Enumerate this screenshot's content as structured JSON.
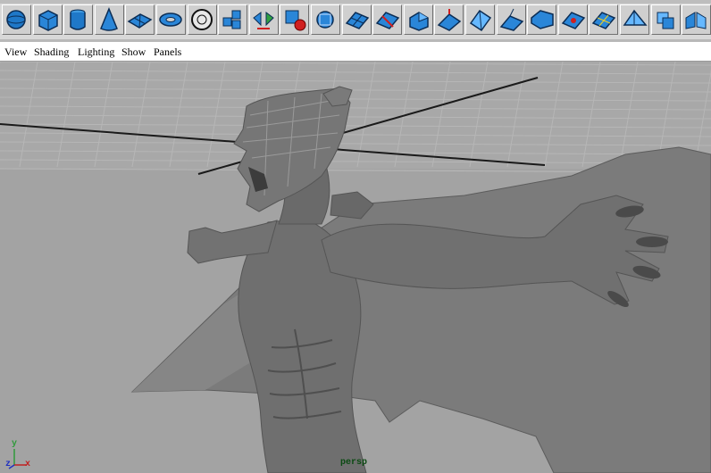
{
  "shelf": {
    "icons": [
      {
        "name": "sphere-icon"
      },
      {
        "name": "cube-icon"
      },
      {
        "name": "cylinder-icon"
      },
      {
        "name": "cone-icon"
      },
      {
        "name": "plane-icon"
      },
      {
        "name": "torus-icon"
      },
      {
        "name": "soccer-ball-icon"
      },
      {
        "name": "combine-icon"
      },
      {
        "name": "separate-icon"
      },
      {
        "name": "extract-icon"
      },
      {
        "name": "smooth-icon"
      },
      {
        "name": "polygon-plane-icon"
      },
      {
        "name": "split-polygon-icon"
      },
      {
        "name": "extrude-face-icon"
      },
      {
        "name": "extrude-edge-icon"
      },
      {
        "name": "bevel-icon"
      },
      {
        "name": "wedge-face-icon"
      },
      {
        "name": "append-polygon-icon"
      },
      {
        "name": "merge-vertices-icon"
      },
      {
        "name": "subdivide-icon"
      },
      {
        "name": "poke-face-icon"
      },
      {
        "name": "duplicate-face-icon"
      },
      {
        "name": "mirror-geometry-icon"
      }
    ]
  },
  "menubar": {
    "view": "View",
    "shading": "Shading",
    "lighting": "Lighting",
    "show": "Show",
    "panels": "Panels"
  },
  "viewport": {
    "camera": "persp",
    "axis_z": "z",
    "axis_x": "x",
    "axis_y": "y",
    "background": "#a3a3a3",
    "model_color": "#6e6e6e",
    "grid_color": "#b8b8b8"
  }
}
